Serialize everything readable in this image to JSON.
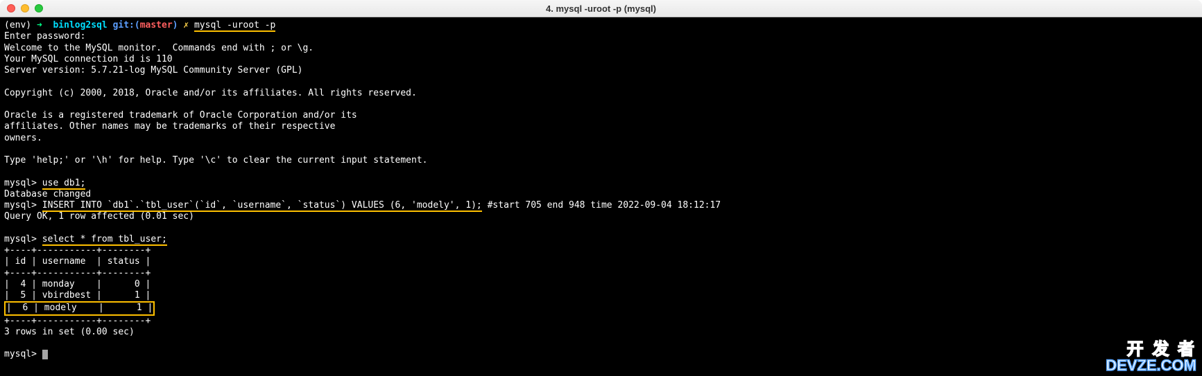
{
  "titlebar": {
    "title": "4. mysql -uroot -p (mysql)"
  },
  "prompt": {
    "env": "(env)",
    "arrow": "➜",
    "path": "binlog2sql",
    "git_label": "git:",
    "branch": "master",
    "dirty": "✗",
    "command": "mysql -uroot -p"
  },
  "output": {
    "enter_password": "Enter password:",
    "welcome": "Welcome to the MySQL monitor.  Commands end with ; or \\g.",
    "conn_id": "Your MySQL connection id is 110",
    "server_version": "Server version: 5.7.21-log MySQL Community Server (GPL)",
    "copyright": "Copyright (c) 2000, 2018, Oracle and/or its affiliates. All rights reserved.",
    "trademark1": "Oracle is a registered trademark of Oracle Corporation and/or its",
    "trademark2": "affiliates. Other names may be trademarks of their respective",
    "trademark3": "owners.",
    "help": "Type 'help;' or '\\h' for help. Type '\\c' to clear the current input statement."
  },
  "sql": {
    "prompt": "mysql>",
    "use_db": "use db1;",
    "db_changed": "Database changed",
    "insert_stmt": "INSERT INTO `db1`.`tbl_user`(`id`, `username`, `status`) VALUES (6, 'modely', 1);",
    "insert_comment": " #start 705 end 948 time 2022-09-04 18:12:17",
    "query_ok": "Query OK, 1 row affected (0.01 sec)",
    "select_stmt": "select * from tbl_user;"
  },
  "table": {
    "border": "+----+-----------+--------+",
    "header": "| id | username  | status |",
    "rows": [
      "|  4 | monday    |      0 |",
      "|  5 | vbirdbest |      1 |",
      "|  6 | modely    |      1 |"
    ],
    "summary": "3 rows in set (0.00 sec)"
  },
  "watermark": {
    "line1": "开 发 者",
    "line2": "DEVZE.COM"
  }
}
